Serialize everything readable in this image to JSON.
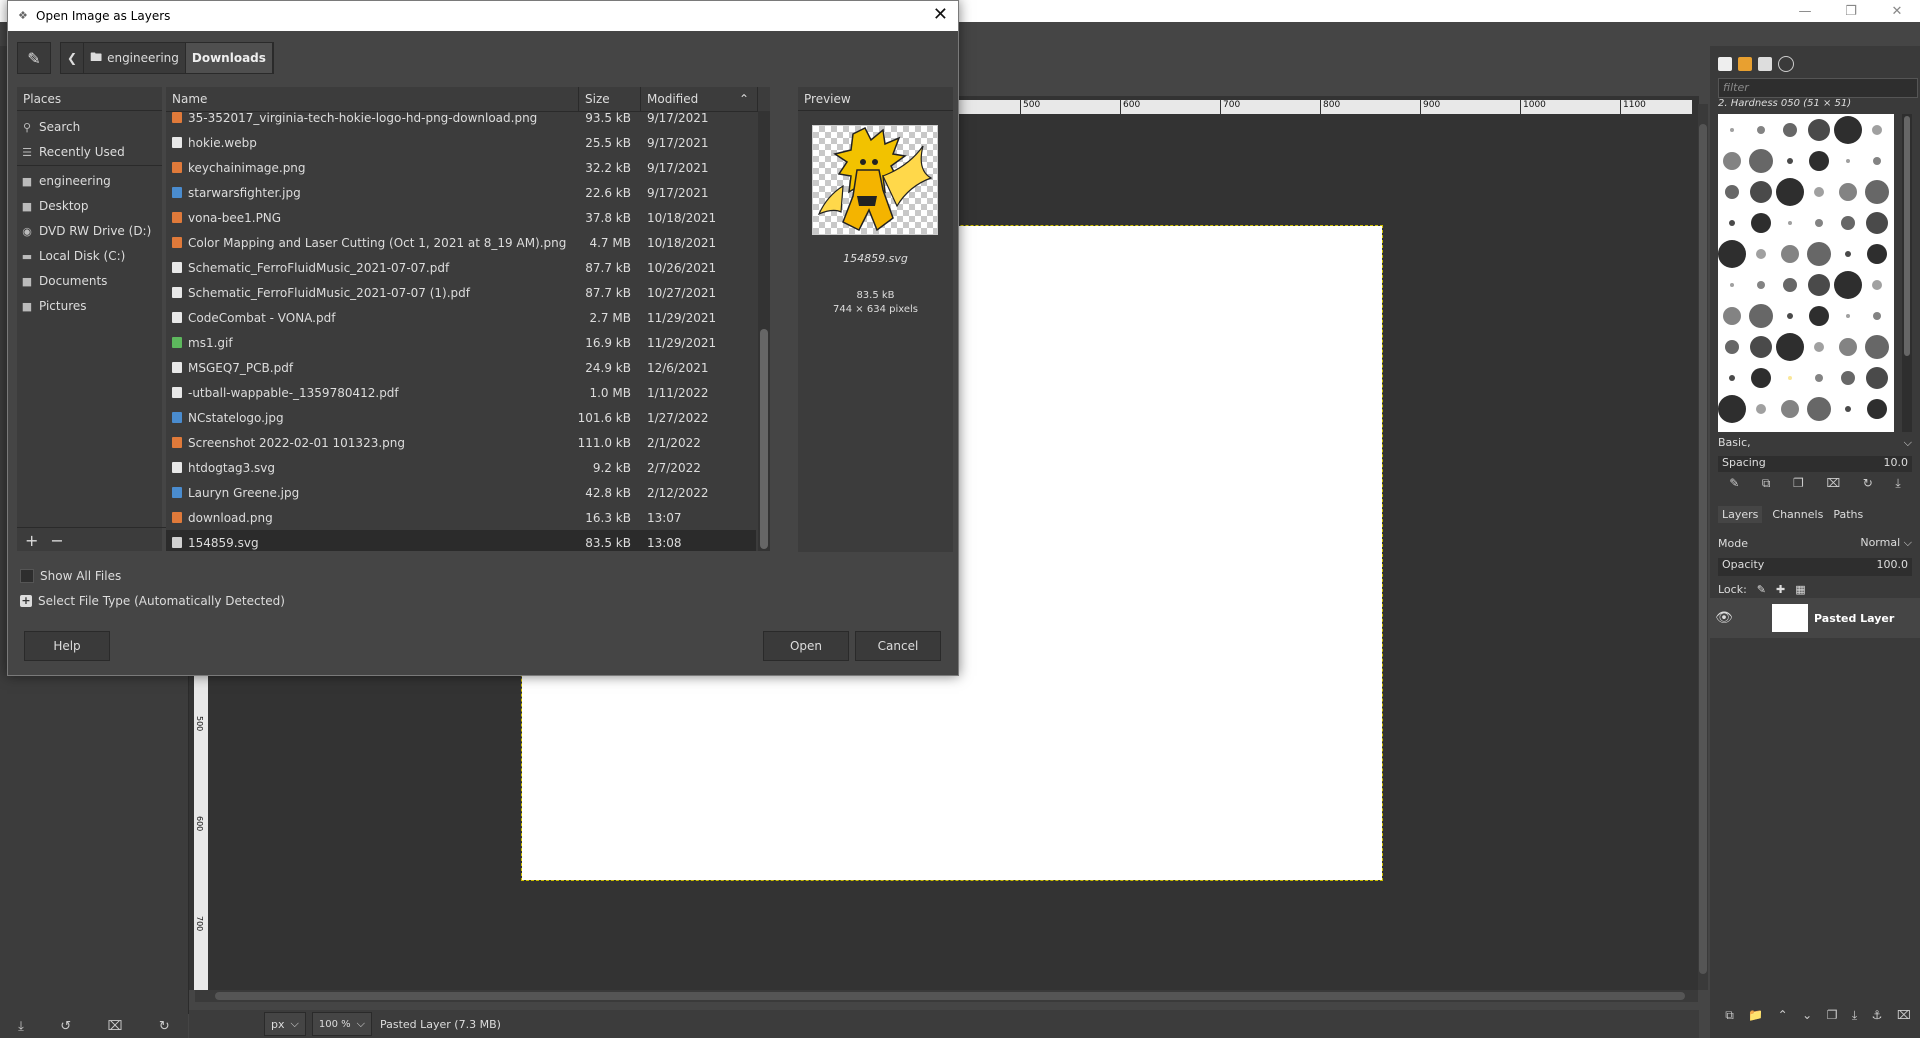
{
  "dialog": {
    "title": "Open Image as Layers",
    "path": [
      "engineering",
      "Downloads"
    ],
    "places": {
      "header": "Places",
      "items": [
        {
          "label": "Search",
          "icon": "search-icon"
        },
        {
          "label": "Recently Used",
          "icon": "recent-icon"
        },
        {
          "label": "engineering",
          "icon": "folder-icon"
        },
        {
          "label": "Desktop",
          "icon": "folder-icon"
        },
        {
          "label": "DVD RW Drive (D:)",
          "icon": "optical-drive-icon"
        },
        {
          "label": "Local Disk (C:)",
          "icon": "disk-icon"
        },
        {
          "label": "Documents",
          "icon": "folder-icon"
        },
        {
          "label": "Pictures",
          "icon": "folder-icon"
        }
      ],
      "add": "+",
      "remove": "−"
    },
    "columns": {
      "name": "Name",
      "size": "Size",
      "modified": "Modified"
    },
    "files": [
      {
        "name": "35-352017_virginia-tech-hokie-logo-hd-png-download.png",
        "size": "93.5 kB",
        "modified": "9/17/2021",
        "type": "png"
      },
      {
        "name": "hokie.webp",
        "size": "25.5 kB",
        "modified": "9/17/2021",
        "type": "doc"
      },
      {
        "name": "keychainimage.png",
        "size": "32.2 kB",
        "modified": "9/17/2021",
        "type": "png"
      },
      {
        "name": "starwarsfighter.jpg",
        "size": "22.6 kB",
        "modified": "9/17/2021",
        "type": "jpg"
      },
      {
        "name": "vona-bee1.PNG",
        "size": "37.8 kB",
        "modified": "10/18/2021",
        "type": "png"
      },
      {
        "name": "Color Mapping and Laser Cutting (Oct 1, 2021 at 8_19 AM).png",
        "size": "4.7 MB",
        "modified": "10/18/2021",
        "type": "png"
      },
      {
        "name": "Schematic_FerroFluidMusic_2021-07-07.pdf",
        "size": "87.7 kB",
        "modified": "10/26/2021",
        "type": "doc"
      },
      {
        "name": "Schematic_FerroFluidMusic_2021-07-07 (1).pdf",
        "size": "87.7 kB",
        "modified": "10/27/2021",
        "type": "doc"
      },
      {
        "name": "CodeCombat - VONA.pdf",
        "size": "2.7 MB",
        "modified": "11/29/2021",
        "type": "doc"
      },
      {
        "name": "ms1.gif",
        "size": "16.9 kB",
        "modified": "11/29/2021",
        "type": "gif"
      },
      {
        "name": "MSGEQ7_PCB.pdf",
        "size": "24.9 kB",
        "modified": "12/6/2021",
        "type": "doc"
      },
      {
        "name": "-utball-wappable-_1359780412.pdf",
        "size": "1.0 MB",
        "modified": "1/11/2022",
        "type": "doc"
      },
      {
        "name": "NCstatelogo.jpg",
        "size": "101.6 kB",
        "modified": "1/27/2022",
        "type": "jpg"
      },
      {
        "name": "Screenshot 2022-02-01 101323.png",
        "size": "111.0 kB",
        "modified": "2/1/2022",
        "type": "png"
      },
      {
        "name": "htdogtag3.svg",
        "size": "9.2 kB",
        "modified": "2/7/2022",
        "type": "doc"
      },
      {
        "name": "Lauryn Greene.jpg",
        "size": "42.8 kB",
        "modified": "2/12/2022",
        "type": "jpg"
      },
      {
        "name": "download.png",
        "size": "16.3 kB",
        "modified": "13:07",
        "type": "png"
      },
      {
        "name": "154859.svg",
        "size": "83.5 kB",
        "modified": "13:08",
        "type": "svg",
        "selected": true
      }
    ],
    "preview": {
      "header": "Preview",
      "filename": "154859.svg",
      "filesize": "83.5 kB",
      "dimensions": "744 × 634 pixels"
    },
    "show_all_files": "Show All Files",
    "select_file_type": "Select File Type (Automatically Detected)",
    "buttons": {
      "help": "Help",
      "open": "Open",
      "cancel": "Cancel"
    }
  },
  "ruler": {
    "h_ticks": [
      "500",
      "600",
      "700",
      "800",
      "900",
      "1000",
      "1100"
    ],
    "v_ticks": [
      "500",
      "600",
      "700"
    ]
  },
  "status": {
    "unit": "px",
    "zoom": "100 %",
    "text": "Pasted Layer (7.3 MB)"
  },
  "right_dock": {
    "filter_placeholder": "filter",
    "brush_name": "2. Hardness 050 (51 × 51)",
    "preset": "Basic,",
    "spacing_label": "Spacing",
    "spacing_value": "10.0",
    "tabs": [
      "Layers",
      "Channels",
      "Paths"
    ],
    "mode_label": "Mode",
    "mode_value": "Normal",
    "opacity_label": "Opacity",
    "opacity_value": "100.0",
    "lock_label": "Lock:",
    "layer_name": "Pasted Layer"
  },
  "colors": {
    "dialog_bg": "#454545",
    "selected_row": "#2b2b2b",
    "png_icon": "#e07a3a",
    "jpg_icon": "#4a8ccf",
    "gif_icon": "#5db85d",
    "preview_yellow": "#f2c200"
  }
}
